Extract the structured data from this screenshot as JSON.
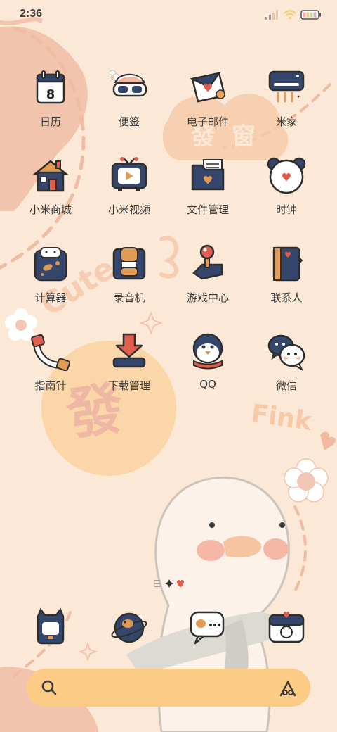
{
  "status_bar": {
    "time": "2:36",
    "signal_icon": "signal-icon",
    "wifi_icon": "wifi-icon",
    "battery_icon": "battery-icon"
  },
  "apps": [
    {
      "label": "日历",
      "icon": "calendar-icon"
    },
    {
      "label": "便签",
      "icon": "notes-goggles-icon"
    },
    {
      "label": "电子邮件",
      "icon": "email-envelope-icon"
    },
    {
      "label": "米家",
      "icon": "mi-home-heater-icon"
    },
    {
      "label": "小米商城",
      "icon": "mi-store-house-icon"
    },
    {
      "label": "小米视频",
      "icon": "mi-video-tv-icon"
    },
    {
      "label": "文件管理",
      "icon": "file-manager-folder-icon"
    },
    {
      "label": "时钟",
      "icon": "clock-bear-icon"
    },
    {
      "label": "计算器",
      "icon": "calculator-icon"
    },
    {
      "label": "录音机",
      "icon": "recorder-icon"
    },
    {
      "label": "游戏中心",
      "icon": "game-joystick-icon"
    },
    {
      "label": "联系人",
      "icon": "contacts-book-icon"
    },
    {
      "label": "指南针",
      "icon": "compass-icon"
    },
    {
      "label": "下载管理",
      "icon": "download-arrow-icon"
    },
    {
      "label": "QQ",
      "icon": "qq-penguin-icon"
    },
    {
      "label": "微信",
      "icon": "wechat-bubbles-icon"
    }
  ],
  "page_indicator": {
    "icons": [
      "pages-menu-icon",
      "sparkle-icon",
      "heart-icon"
    ]
  },
  "dock": [
    {
      "icon": "phone-icon"
    },
    {
      "icon": "browser-planet-icon"
    },
    {
      "icon": "messages-bubble-icon"
    },
    {
      "icon": "camera-icon"
    }
  ],
  "search_bar": {
    "search_icon": "search-icon",
    "assistant_icon": "assistant-icon"
  },
  "wallpaper": {
    "texts": [
      "Cute",
      "Fink",
      "發",
      "發",
      "窗"
    ],
    "colors": {
      "background": "#fbe8d6",
      "blob": "#f2c4ad",
      "sun": "#fbd6a8",
      "search": "#fccc86",
      "navy": "#34466b"
    }
  }
}
